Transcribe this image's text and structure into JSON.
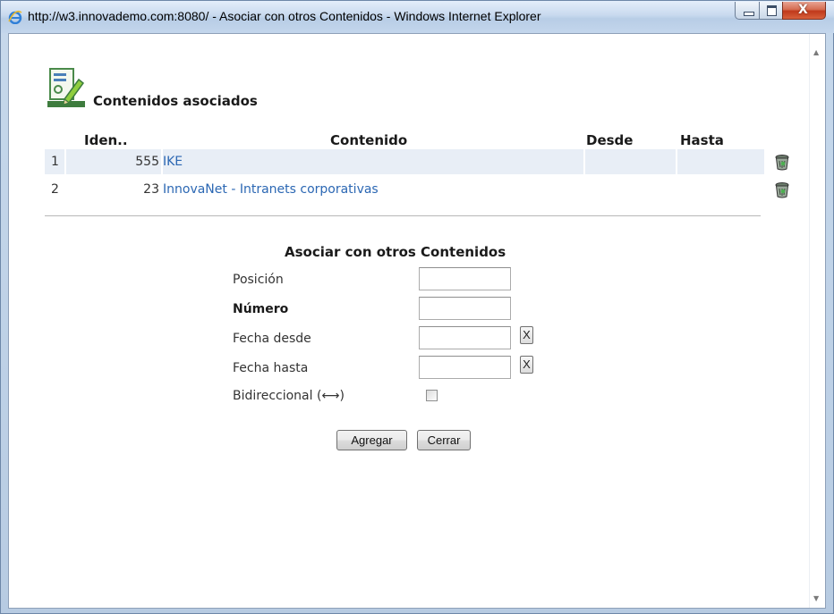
{
  "window": {
    "title": "http://w3.innovademo.com:8080/ - Asociar con otros Contenidos - Windows Internet Explorer",
    "close_glyph": "X"
  },
  "header": {
    "title": "Contenidos asociados"
  },
  "table": {
    "columns": [
      "Iden..",
      "Contenido",
      "Desde",
      "Hasta"
    ],
    "rows": [
      {
        "pos": "1",
        "id": "555",
        "content": "IKE",
        "desde": "",
        "hasta": ""
      },
      {
        "pos": "2",
        "id": "23",
        "content": "InnovaNet - Intranets corporativas",
        "desde": "",
        "hasta": ""
      }
    ]
  },
  "form": {
    "title": "Asociar con otros Contenidos",
    "posicion_label": "Posición",
    "numero_label": "Número",
    "fecha_desde_label": "Fecha desde",
    "fecha_hasta_label": "Fecha hasta",
    "bidireccional_label": "Bidireccional  (⟷)",
    "posicion_value": "",
    "numero_value": "",
    "fecha_desde_value": "",
    "fecha_hasta_value": "",
    "clear_label": "X",
    "bidireccional_checked": false,
    "add_button": "Agregar",
    "close_button": "Cerrar"
  },
  "icons": {
    "browser": "internet-explorer-icon",
    "document": "document-edit-icon",
    "delete": "trash-icon"
  },
  "colors": {
    "link": "#2b67b3",
    "row_highlight": "#e8eef6",
    "close_button": "#c0391b"
  }
}
